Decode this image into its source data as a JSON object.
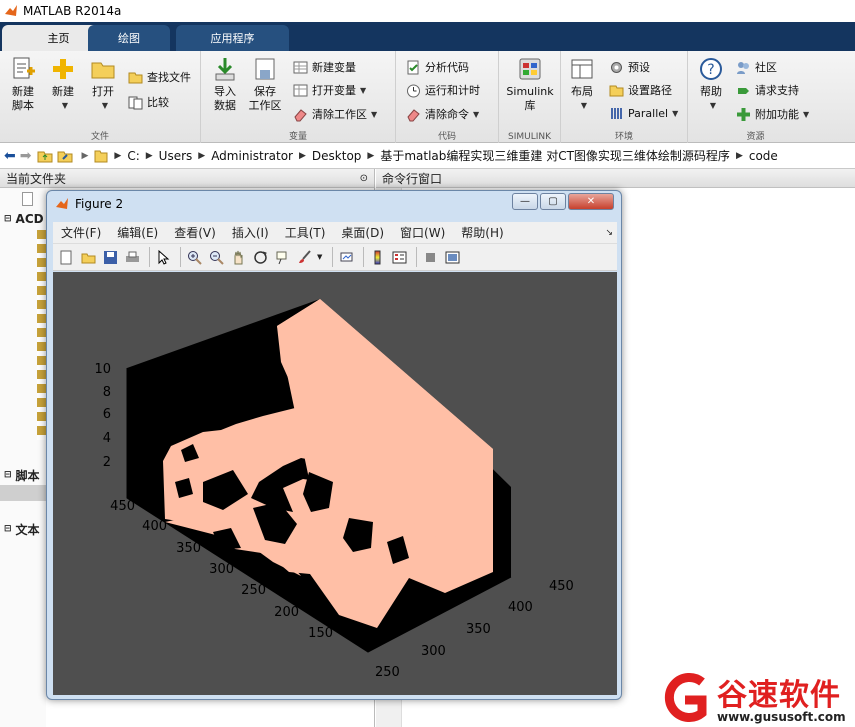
{
  "window": {
    "title": "MATLAB R2014a"
  },
  "tabs": [
    {
      "label": "主页",
      "active": true
    },
    {
      "label": "绘图",
      "active": false
    },
    {
      "label": "应用程序",
      "active": false
    }
  ],
  "ribbon": {
    "file": {
      "new_script": [
        "新建",
        "脚本"
      ],
      "new": "新建",
      "open": "打开",
      "find_files": "查找文件",
      "compare": "比较",
      "group": "文件"
    },
    "variable": {
      "import": [
        "导入",
        "数据"
      ],
      "save": [
        "保存",
        "工作区"
      ],
      "new_var": "新建变量",
      "open_var": "打开变量",
      "clear_ws": "清除工作区",
      "group": "变量"
    },
    "code": {
      "analyze": "分析代码",
      "run_time": "运行和计时",
      "clear_cmd": "清除命令",
      "group": "代码"
    },
    "simulink": {
      "label": [
        "Simulink",
        "库"
      ],
      "group": "SIMULINK"
    },
    "env": {
      "layout": "布局",
      "prefs": "预设",
      "set_path": "设置路径",
      "parallel": "Parallel",
      "group": "环境"
    },
    "resources": {
      "help": "帮助",
      "community": "社区",
      "support": "请求支持",
      "addons": "附加功能",
      "group": "资源"
    }
  },
  "address": [
    "C:",
    "Users",
    "Administrator",
    "Desktop",
    "基于matlab编程实现三维重建 对CT图像实现三维体绘制源码程序",
    "code"
  ],
  "left_panel": {
    "header": "当前文件夹",
    "sections": [
      "ACD",
      "脚本",
      "文本"
    ]
  },
  "cmd_panel": {
    "header": "命令行窗口"
  },
  "figure": {
    "title": "Figure 2",
    "menu": [
      "文件(F)",
      "编辑(E)",
      "查看(V)",
      "插入(I)",
      "工具(T)",
      "桌面(D)",
      "窗口(W)",
      "帮助(H)"
    ],
    "z_ticks": [
      "10",
      "8",
      "6",
      "4",
      "2"
    ],
    "y_ticks": [
      "450",
      "400",
      "350",
      "300",
      "250",
      "200",
      "150"
    ],
    "x_ticks": [
      "450",
      "400",
      "350",
      "300",
      "250"
    ],
    "colors": {
      "background": "#4f4f4f",
      "volume": "#ffbfa6",
      "axes": "#000000"
    }
  },
  "watermark": {
    "brand": "谷速软件",
    "url": "www.gususoft.com",
    "color": "#e02020"
  }
}
